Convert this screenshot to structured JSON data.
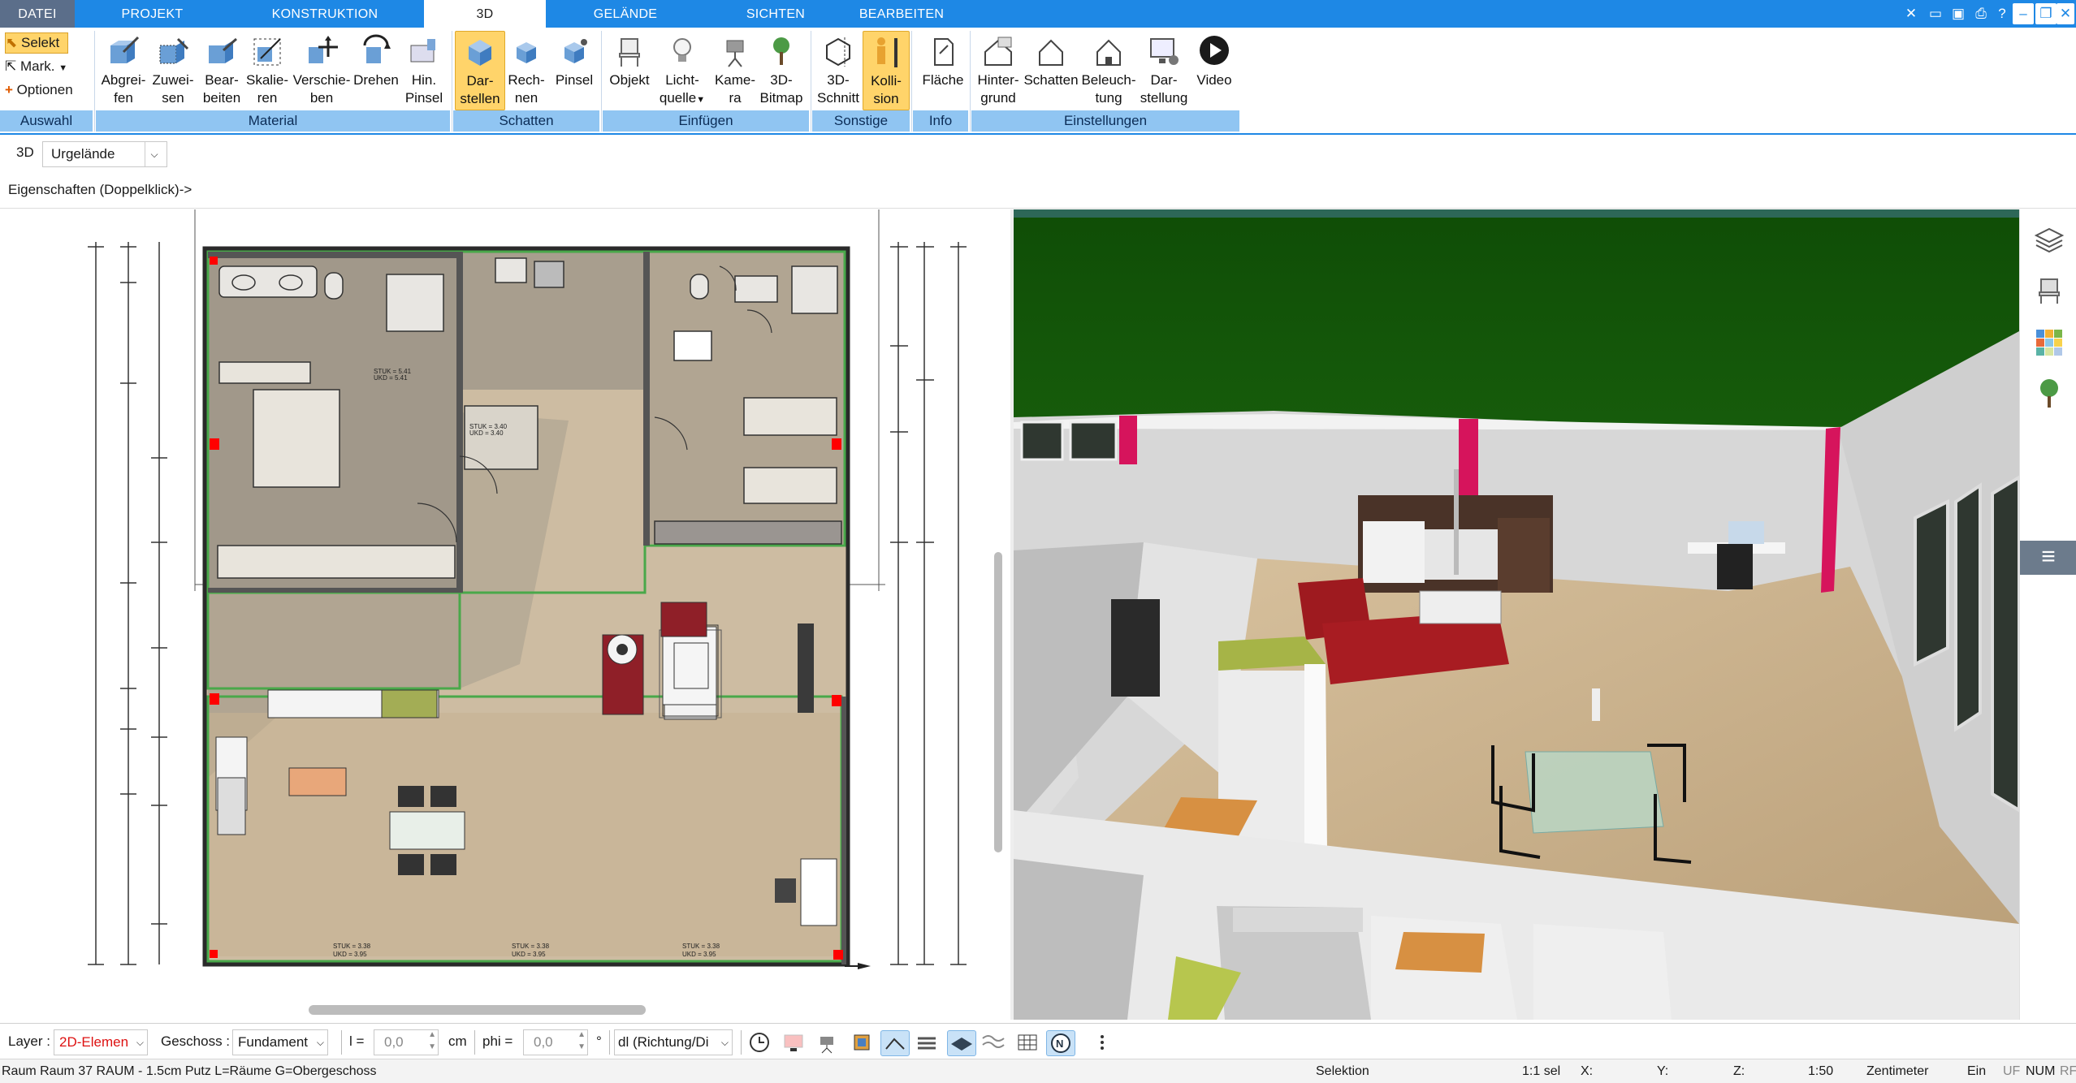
{
  "tabs": [
    {
      "label": "DATEI"
    },
    {
      "label": "PROJEKT"
    },
    {
      "label": "KONSTRUKTION"
    },
    {
      "label": "3D"
    },
    {
      "label": "GELÄNDE"
    },
    {
      "label": "SICHTEN"
    },
    {
      "label": "BEARBEITEN"
    }
  ],
  "ribbon": {
    "selection": {
      "selekt": "Selekt",
      "mark": "Mark.",
      "optionen": "Optionen"
    },
    "buttons": {
      "abgreifen": [
        "Abgrei-",
        "fen"
      ],
      "zuweisen": [
        "Zuwei-",
        "sen"
      ],
      "bearbeiten": [
        "Bear-",
        "beiten"
      ],
      "skalieren": [
        "Skalie-",
        "ren"
      ],
      "verschieben": [
        "Verschie-",
        "ben"
      ],
      "drehen": [
        "Drehen",
        ""
      ],
      "hinpinsel": [
        "Hin.",
        "Pinsel"
      ],
      "darstellen": [
        "Dar-",
        "stellen"
      ],
      "rechnen": [
        "Rech-",
        "nen"
      ],
      "pinsel": [
        "Pinsel",
        ""
      ],
      "objekt": [
        "Objekt",
        ""
      ],
      "lichtquelle": [
        "Licht-",
        "quelle"
      ],
      "kamera": [
        "Kame-",
        "ra"
      ],
      "bitmap3d": [
        "3D-",
        "Bitmap"
      ],
      "schnitt3d": [
        "3D-",
        "Schnitt"
      ],
      "kollision": [
        "Kolli-",
        "sion"
      ],
      "flaeche": [
        "Fläche",
        ""
      ],
      "hintergrund": [
        "Hinter-",
        "grund"
      ],
      "schatten": [
        "Schatten",
        ""
      ],
      "beleuchtung": [
        "Beleuch-",
        "tung"
      ],
      "darstellung": [
        "Dar-",
        "stellung"
      ],
      "video": [
        "Video",
        ""
      ]
    },
    "groups": {
      "auswahl": "Auswahl",
      "material": "Material",
      "schatten": "Schatten",
      "einfuegen": "Einfügen",
      "sonstige": "Sonstige",
      "info": "Info",
      "einstellungen": "Einstellungen"
    }
  },
  "subbar": {
    "mode": "3D",
    "terrain": "Urgelände"
  },
  "properties_hint": "Eigenschaften (Doppelklick)->",
  "bottom": {
    "layer_label": "Layer :",
    "layer_value": "2D-Elemen",
    "geschoss_label": "Geschoss :",
    "geschoss_value": "Fundament",
    "l_label": "l =",
    "l_value": "0,0",
    "l_unit": "cm",
    "phi_label": "phi =",
    "phi_value": "0,0",
    "phi_unit": "°",
    "dl_value": "dl (Richtung/Di"
  },
  "status": {
    "left": "Raum Raum 37 RAUM - 1.5cm Putz L=Räume G=Obergeschoss",
    "mode": "Selektion",
    "sel": "1:1 sel",
    "x": "X:",
    "y": "Y:",
    "z": "Z:",
    "scale": "1:50",
    "unit": "Zentimeter",
    "ein": "Ein",
    "uf": "UF",
    "num": "NUM",
    "rf": "RF"
  },
  "plan_labels": {
    "stuk1": "STUK = 3.38",
    "ukd1": "UKD = 3.95",
    "stuk2": "STUK = 3.38",
    "ukd2": "UKD = 3.95",
    "stuk3": "STUK = 3.38",
    "ukd3": "UKD = 3.95",
    "stuk4": "STUK = 5.41",
    "ukd4": "UKD = 5.41",
    "stuk5": "STUK = 3.40",
    "ukd5": "UKD = 3.40"
  },
  "colors": {
    "accent": "#1e88e5",
    "selected": "#ffd46a",
    "group": "#90c5f2",
    "grass": "#1f6b12",
    "floor": "#c8b08c",
    "wall": "#d9d9d9",
    "accentwall": "#d6145c"
  }
}
